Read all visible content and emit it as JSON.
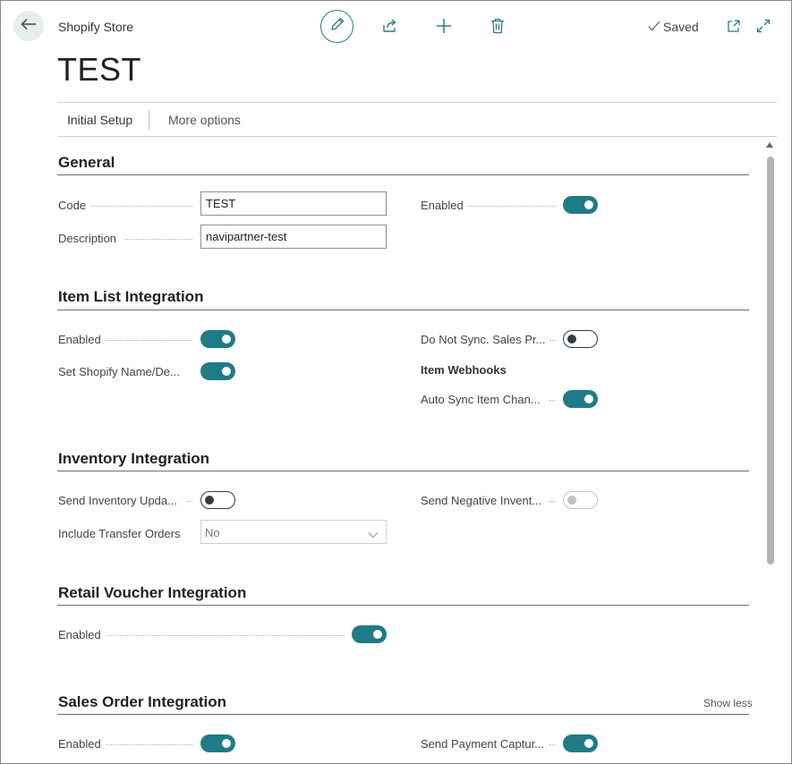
{
  "header": {
    "caption": "Shopify Store",
    "title": "TEST",
    "saved_label": "Saved"
  },
  "icons": {
    "back": "back-arrow-icon",
    "edit": "pencil-icon",
    "share": "share-icon",
    "add": "plus-icon",
    "delete": "trash-icon",
    "saved": "checkmark-icon",
    "open_new": "open-in-new-window-icon",
    "expand": "expand-icon"
  },
  "actions": {
    "initial_setup": "Initial Setup",
    "more_options": "More options"
  },
  "general": {
    "title": "General",
    "code_label": "Code",
    "code_value": "TEST",
    "description_label": "Description",
    "description_value": "navipartner-test",
    "enabled_label": "Enabled",
    "enabled_state": "on"
  },
  "item_list": {
    "title": "Item List Integration",
    "enabled_label": "Enabled",
    "enabled_state": "on",
    "set_name_label": "Set Shopify Name/De...",
    "set_name_state": "on",
    "do_not_sync_label": "Do Not Sync. Sales Pr...",
    "do_not_sync_state": "off",
    "webhooks_heading": "Item Webhooks",
    "auto_sync_label": "Auto Sync Item Chan...",
    "auto_sync_state": "on"
  },
  "inventory": {
    "title": "Inventory Integration",
    "send_updates_label": "Send Inventory Upda...",
    "send_updates_state": "off",
    "transfer_orders_label": "Include Transfer Orders",
    "transfer_orders_value": "No",
    "send_negative_label": "Send Negative Invent...",
    "send_negative_state": "disabled"
  },
  "retail_voucher": {
    "title": "Retail Voucher Integration",
    "enabled_label": "Enabled",
    "enabled_state": "on"
  },
  "sales_order": {
    "title": "Sales Order Integration",
    "show_less": "Show less",
    "enabled_label": "Enabled",
    "enabled_state": "on",
    "payment_capture_label": "Send Payment Captur...",
    "payment_capture_state": "on"
  },
  "colors": {
    "accent": "#1f7b86",
    "toggle_off": "#333c43",
    "toggle_disabled": "#c2c2c2",
    "back_button_bg": "#e6eeee"
  }
}
